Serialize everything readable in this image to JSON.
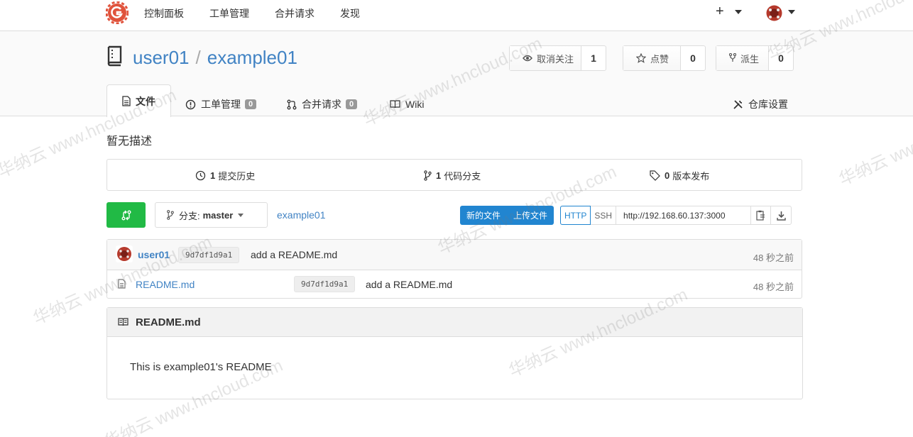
{
  "nav": {
    "logo": "gitea-logo-icon",
    "links": [
      "控制面板",
      "工单管理",
      "合并请求",
      "发现"
    ],
    "plus": "+"
  },
  "repo": {
    "owner": "user01",
    "separator": "/",
    "name": "example01",
    "watch": {
      "label": "取消关注",
      "count": "1",
      "icon": "eye-icon"
    },
    "star": {
      "label": "点赞",
      "count": "0",
      "icon": "star-icon"
    },
    "fork": {
      "label": "派生",
      "count": "0",
      "icon": "fork-icon"
    }
  },
  "tabs": {
    "code": "文件",
    "issues": "工单管理",
    "issues_count": "0",
    "pulls": "合并请求",
    "pulls_count": "0",
    "wiki": "Wiki",
    "settings": "仓库设置"
  },
  "description": "暂无描述",
  "stats": {
    "commits_count": "1",
    "commits_label": "提交历史",
    "branches_count": "1",
    "branches_label": "代码分支",
    "releases_count": "0",
    "releases_label": "版本发布"
  },
  "toolbar": {
    "branch_prefix": "分支:",
    "branch_name": "master",
    "breadcrumb": "example01",
    "new_file": "新的文件",
    "upload_file": "上传文件",
    "http": "HTTP",
    "ssh": "SSH",
    "clone_url": "http://192.168.60.137:3000"
  },
  "latest_commit": {
    "author": "user01",
    "sha": "9d7df1d9a1",
    "message": "add a README.md",
    "time": "48 秒之前"
  },
  "files": [
    {
      "name": "README.md",
      "sha": "9d7df1d9a1",
      "message": "add a README.md",
      "time": "48 秒之前"
    }
  ],
  "readme": {
    "title": "README.md",
    "content": "This is example01's README"
  },
  "watermark": "华纳云 www.hncloud.com",
  "colors": {
    "accent": "#4183c4",
    "green": "#21ba45",
    "blue": "#2185d0",
    "logo": "#e0533c"
  }
}
